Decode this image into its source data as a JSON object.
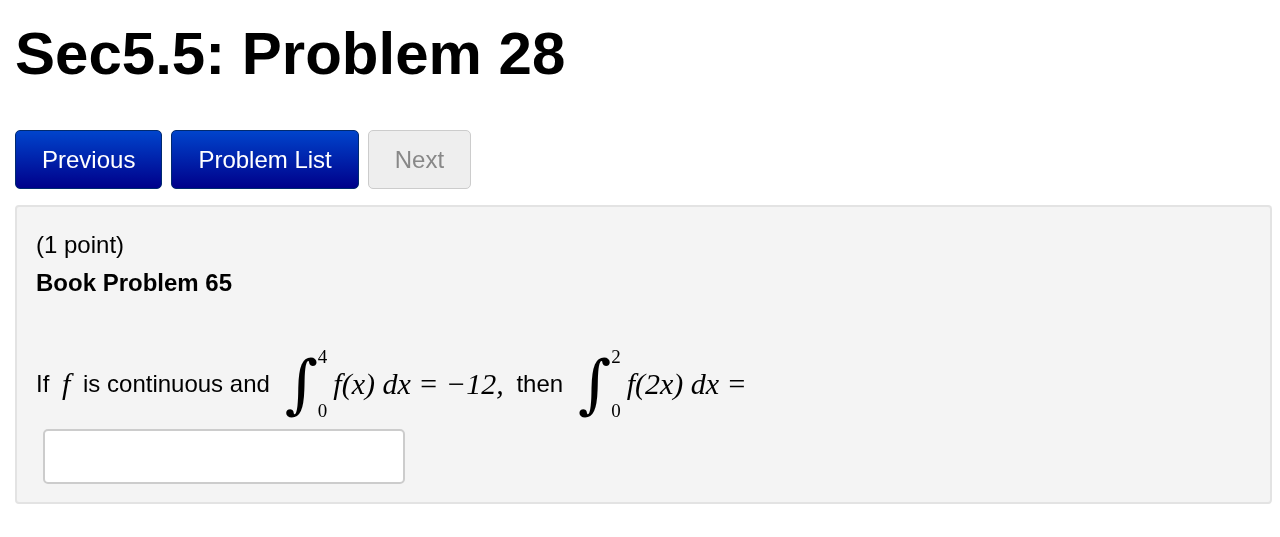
{
  "title": "Sec5.5: Problem 28",
  "buttons": [
    {
      "label": "Previous",
      "disabled": false
    },
    {
      "label": "Problem List",
      "disabled": false
    },
    {
      "label": "Next",
      "disabled": true
    }
  ],
  "problem": {
    "points": "(1 point)",
    "heading": "Book Problem 65",
    "statement": [
      {
        "kind": "text",
        "text": "If "
      },
      {
        "kind": "math",
        "text": "f"
      },
      {
        "kind": "text",
        "text": " is continuous and "
      },
      {
        "kind": "integral",
        "sign": "∫",
        "lower": "0",
        "upper": "4"
      },
      {
        "kind": "math",
        "text": "f(x) dx = −12,"
      },
      {
        "kind": "text",
        "text": " then "
      },
      {
        "kind": "integral",
        "sign": "∫",
        "lower": "0",
        "upper": "2"
      },
      {
        "kind": "math",
        "text": "f(2x) dx ="
      }
    ]
  }
}
